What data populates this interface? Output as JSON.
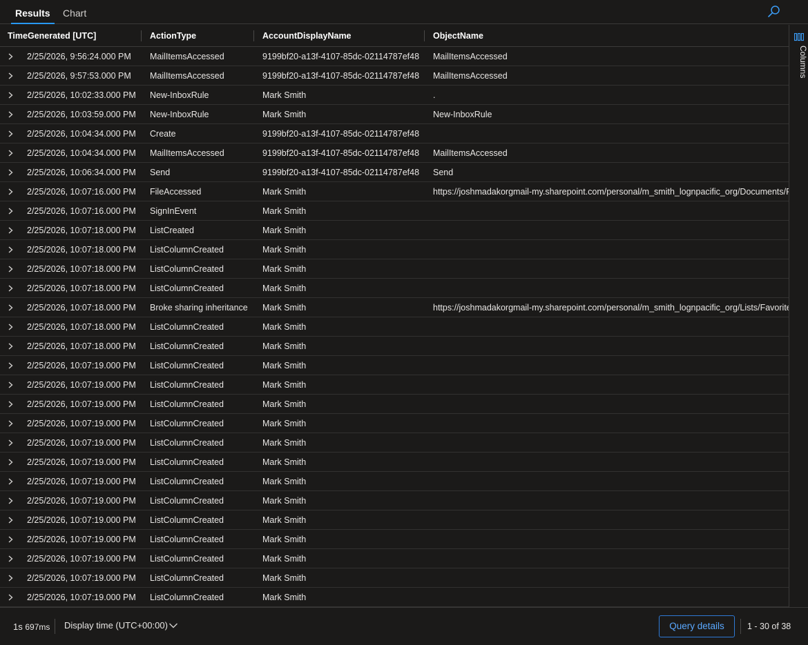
{
  "tabs": [
    {
      "label": "Results",
      "active": true
    },
    {
      "label": "Chart",
      "active": false
    }
  ],
  "icons": {
    "search": "search-icon",
    "columns": "columns-icon",
    "expand": "chevron-right-icon",
    "dropdown": "chevron-down-icon"
  },
  "colors": {
    "accent": "#2899f5",
    "background": "#1b1a19",
    "button_border": "#2f7ad6",
    "button_text": "#5aa8ff"
  },
  "grid": {
    "columns": [
      "TimeGenerated [UTC]",
      "ActionType",
      "AccountDisplayName",
      "ObjectName"
    ],
    "rows": [
      [
        "2/25/2026, 9:56:24.000 PM",
        "MailItemsAccessed",
        "9199bf20-a13f-4107-85dc-02114787ef48",
        "MailItemsAccessed"
      ],
      [
        "2/25/2026, 9:57:53.000 PM",
        "MailItemsAccessed",
        "9199bf20-a13f-4107-85dc-02114787ef48",
        "MailItemsAccessed"
      ],
      [
        "2/25/2026, 10:02:33.000 PM",
        "New-InboxRule",
        "Mark Smith",
        "."
      ],
      [
        "2/25/2026, 10:03:59.000 PM",
        "New-InboxRule",
        "Mark Smith",
        "New-InboxRule"
      ],
      [
        "2/25/2026, 10:04:34.000 PM",
        "Create",
        "9199bf20-a13f-4107-85dc-02114787ef48",
        ""
      ],
      [
        "2/25/2026, 10:04:34.000 PM",
        "MailItemsAccessed",
        "9199bf20-a13f-4107-85dc-02114787ef48",
        "MailItemsAccessed"
      ],
      [
        "2/25/2026, 10:06:34.000 PM",
        "Send",
        "9199bf20-a13f-4107-85dc-02114787ef48",
        "Send"
      ],
      [
        "2/25/2026, 10:07:16.000 PM",
        "FileAccessed",
        "Mark Smith",
        "https://joshmadakorgmail-my.sharepoint.com/personal/m_smith_lognpacific_org/Documents/For"
      ],
      [
        "2/25/2026, 10:07:16.000 PM",
        "SignInEvent",
        "Mark Smith",
        ""
      ],
      [
        "2/25/2026, 10:07:18.000 PM",
        "ListCreated",
        "Mark Smith",
        ""
      ],
      [
        "2/25/2026, 10:07:18.000 PM",
        "ListColumnCreated",
        "Mark Smith",
        ""
      ],
      [
        "2/25/2026, 10:07:18.000 PM",
        "ListColumnCreated",
        "Mark Smith",
        ""
      ],
      [
        "2/25/2026, 10:07:18.000 PM",
        "ListColumnCreated",
        "Mark Smith",
        ""
      ],
      [
        "2/25/2026, 10:07:18.000 PM",
        "Broke sharing inheritance",
        "Mark Smith",
        "https://joshmadakorgmail-my.sharepoint.com/personal/m_smith_lognpacific_org/Lists/FavoriteLis"
      ],
      [
        "2/25/2026, 10:07:18.000 PM",
        "ListColumnCreated",
        "Mark Smith",
        ""
      ],
      [
        "2/25/2026, 10:07:18.000 PM",
        "ListColumnCreated",
        "Mark Smith",
        ""
      ],
      [
        "2/25/2026, 10:07:19.000 PM",
        "ListColumnCreated",
        "Mark Smith",
        ""
      ],
      [
        "2/25/2026, 10:07:19.000 PM",
        "ListColumnCreated",
        "Mark Smith",
        ""
      ],
      [
        "2/25/2026, 10:07:19.000 PM",
        "ListColumnCreated",
        "Mark Smith",
        ""
      ],
      [
        "2/25/2026, 10:07:19.000 PM",
        "ListColumnCreated",
        "Mark Smith",
        ""
      ],
      [
        "2/25/2026, 10:07:19.000 PM",
        "ListColumnCreated",
        "Mark Smith",
        ""
      ],
      [
        "2/25/2026, 10:07:19.000 PM",
        "ListColumnCreated",
        "Mark Smith",
        ""
      ],
      [
        "2/25/2026, 10:07:19.000 PM",
        "ListColumnCreated",
        "Mark Smith",
        ""
      ],
      [
        "2/25/2026, 10:07:19.000 PM",
        "ListColumnCreated",
        "Mark Smith",
        ""
      ],
      [
        "2/25/2026, 10:07:19.000 PM",
        "ListColumnCreated",
        "Mark Smith",
        ""
      ],
      [
        "2/25/2026, 10:07:19.000 PM",
        "ListColumnCreated",
        "Mark Smith",
        ""
      ],
      [
        "2/25/2026, 10:07:19.000 PM",
        "ListColumnCreated",
        "Mark Smith",
        ""
      ],
      [
        "2/25/2026, 10:07:19.000 PM",
        "ListColumnCreated",
        "Mark Smith",
        ""
      ],
      [
        "2/25/2026, 10:07:19.000 PM",
        "ListColumnCreated",
        "Mark Smith",
        ""
      ]
    ]
  },
  "side_panel": {
    "columns_label": "Columns"
  },
  "footer": {
    "duration_seconds": "1s",
    "duration_ms": "697ms",
    "display_time": "Display time (UTC+00:00)",
    "query_details_label": "Query details",
    "paging": "1 - 30 of 38"
  }
}
